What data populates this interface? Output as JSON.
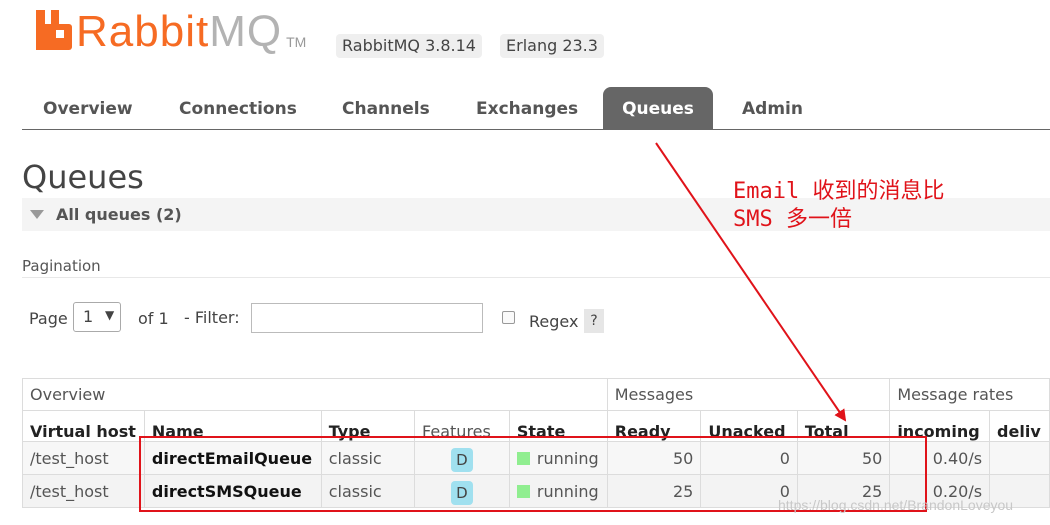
{
  "header": {
    "logo_rabbit": "Rabbit",
    "logo_mq": "MQ",
    "logo_tm": "TM",
    "version_rabbitmq": "RabbitMQ 3.8.14",
    "version_erlang": "Erlang 23.3"
  },
  "nav": {
    "tabs": [
      {
        "label": "Overview"
      },
      {
        "label": "Connections"
      },
      {
        "label": "Channels"
      },
      {
        "label": "Exchanges"
      },
      {
        "label": "Queues",
        "active": true
      },
      {
        "label": "Admin"
      }
    ]
  },
  "page": {
    "title": "Queues",
    "section_label": "All queues (2)",
    "pagination_label": "Pagination",
    "page_label": "Page",
    "page_value": "1",
    "of_label": "of 1",
    "filter_label": "- Filter:",
    "filter_value": "",
    "regex_label": "Regex",
    "help_label": "?"
  },
  "table": {
    "groups": [
      "Overview",
      "Messages",
      "Message rates"
    ],
    "columns": [
      "Virtual host",
      "Name",
      "Type",
      "Features",
      "State",
      "Ready",
      "Unacked",
      "Total",
      "incoming",
      "deliv"
    ],
    "rows": [
      {
        "vhost": "/test_host",
        "name": "directEmailQueue",
        "type": "classic",
        "feature": "D",
        "state": "running",
        "ready": "50",
        "unacked": "0",
        "total": "50",
        "incoming": "0.40/s"
      },
      {
        "vhost": "/test_host",
        "name": "directSMSQueue",
        "type": "classic",
        "feature": "D",
        "state": "running",
        "ready": "25",
        "unacked": "0",
        "total": "25",
        "incoming": "0.20/s"
      }
    ]
  },
  "annotation": {
    "line1": "Email 收到的消息比",
    "line2": "SMS 多一倍",
    "color": "#e0131a"
  },
  "watermark": "https://blog.csdn.net/BrandonLoveyou"
}
